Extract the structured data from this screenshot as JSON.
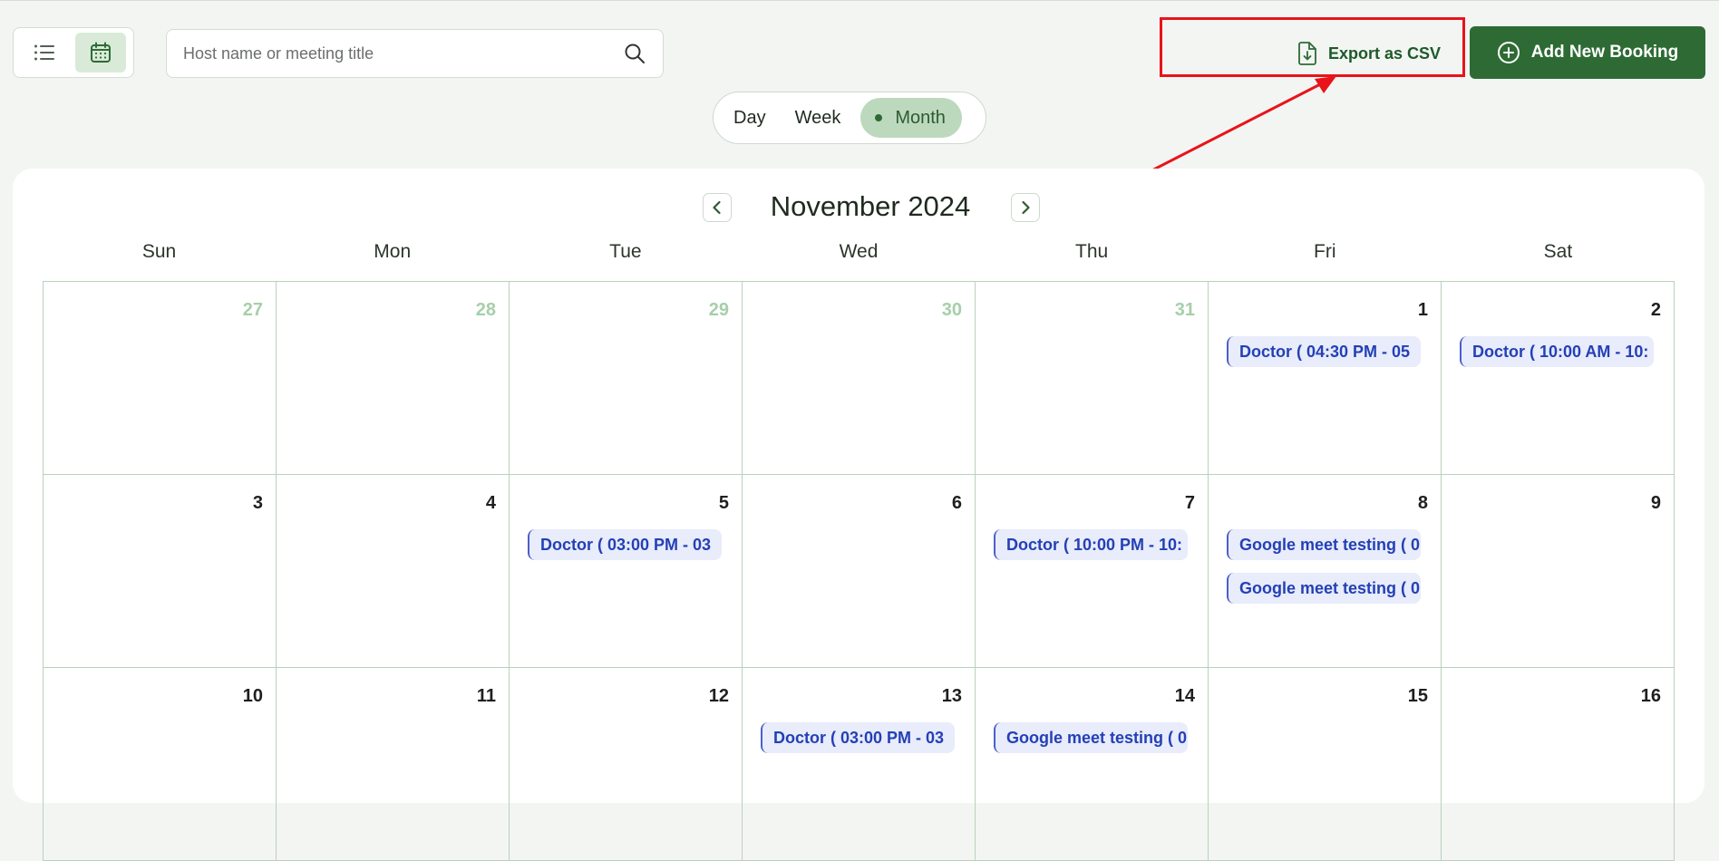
{
  "search": {
    "placeholder": "Host name or meeting title"
  },
  "toolbar": {
    "export_label": "Export as CSV",
    "add_label": "Add New Booking"
  },
  "range_tabs": [
    {
      "label": "Day",
      "active": false
    },
    {
      "label": "Week",
      "active": false
    },
    {
      "label": "Month",
      "active": true
    }
  ],
  "calendar": {
    "month_title": "November 2024",
    "weekdays": [
      "Sun",
      "Mon",
      "Tue",
      "Wed",
      "Thu",
      "Fri",
      "Sat"
    ],
    "weeks": [
      [
        {
          "day": "27",
          "muted": true,
          "events": []
        },
        {
          "day": "28",
          "muted": true,
          "events": []
        },
        {
          "day": "29",
          "muted": true,
          "events": []
        },
        {
          "day": "30",
          "muted": true,
          "events": []
        },
        {
          "day": "31",
          "muted": true,
          "events": []
        },
        {
          "day": "1",
          "muted": false,
          "events": [
            "Doctor ( 04:30 PM - 05"
          ]
        },
        {
          "day": "2",
          "muted": false,
          "events": [
            "Doctor ( 10:00 AM - 10:"
          ]
        }
      ],
      [
        {
          "day": "3",
          "muted": false,
          "events": []
        },
        {
          "day": "4",
          "muted": false,
          "events": []
        },
        {
          "day": "5",
          "muted": false,
          "events": [
            "Doctor ( 03:00 PM - 03"
          ]
        },
        {
          "day": "6",
          "muted": false,
          "events": []
        },
        {
          "day": "7",
          "muted": false,
          "events": [
            "Doctor ( 10:00 PM - 10:"
          ]
        },
        {
          "day": "8",
          "muted": false,
          "events": [
            "Google meet testing ( 0",
            "Google meet testing ( 0"
          ]
        },
        {
          "day": "9",
          "muted": false,
          "events": []
        }
      ],
      [
        {
          "day": "10",
          "muted": false,
          "events": []
        },
        {
          "day": "11",
          "muted": false,
          "events": []
        },
        {
          "day": "12",
          "muted": false,
          "events": []
        },
        {
          "day": "13",
          "muted": false,
          "events": [
            "Doctor ( 03:00 PM - 03"
          ]
        },
        {
          "day": "14",
          "muted": false,
          "events": [
            "Google meet testing ( 0"
          ]
        },
        {
          "day": "15",
          "muted": false,
          "events": []
        },
        {
          "day": "16",
          "muted": false,
          "events": []
        }
      ]
    ]
  },
  "colors": {
    "accent": "#2e6b34",
    "event_bg": "#e8ecfb",
    "event_text": "#2440b5",
    "highlight": "#e8141a"
  }
}
